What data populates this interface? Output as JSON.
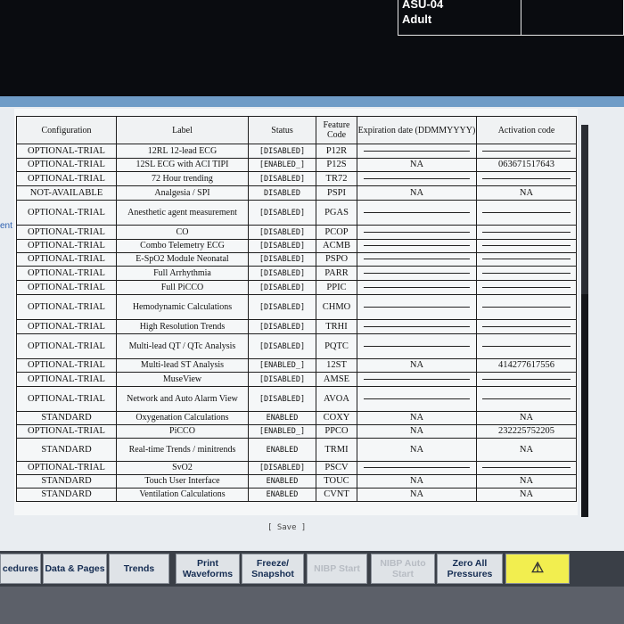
{
  "patient": {
    "line1": "ASU-04",
    "line2": "Adult"
  },
  "side_label": "ent",
  "table": {
    "headers": {
      "config": "Configuration",
      "label": "Label",
      "status": "Status",
      "feature": "Feature Code",
      "expiration": "Expiration date (DDMMYYYY)",
      "activation": "Activation code"
    },
    "rows": [
      {
        "config": "OPTIONAL-TRIAL",
        "label": "12RL 12-lead ECG",
        "status": "[DISABLED]",
        "feature": "P12R",
        "exp": "",
        "act": ""
      },
      {
        "config": "OPTIONAL-TRIAL",
        "label": "12SL ECG with ACI TIPI",
        "status": "[ENABLED_]",
        "feature": "P12S",
        "exp": "NA",
        "act": "063671517643"
      },
      {
        "config": "OPTIONAL-TRIAL",
        "label": "72 Hour trending",
        "status": "[DISABLED]",
        "feature": "TR72",
        "exp": "",
        "act": ""
      },
      {
        "config": "NOT-AVAILABLE",
        "label": "Analgesia / SPI",
        "status": "DISABLED",
        "feature": "PSPI",
        "exp": "NA",
        "act": "NA"
      },
      {
        "config": "OPTIONAL-TRIAL",
        "label": "Anesthetic agent measurement",
        "status": "[DISABLED]",
        "feature": "PGAS",
        "exp": "",
        "act": ""
      },
      {
        "config": "OPTIONAL-TRIAL",
        "label": "CO",
        "status": "[DISABLED]",
        "feature": "PCOP",
        "exp": "",
        "act": ""
      },
      {
        "config": "OPTIONAL-TRIAL",
        "label": "Combo Telemetry ECG",
        "status": "[DISABLED]",
        "feature": "ACMB",
        "exp": "",
        "act": ""
      },
      {
        "config": "OPTIONAL-TRIAL",
        "label": "E-SpO2 Module Neonatal",
        "status": "[DISABLED]",
        "feature": "PSPO",
        "exp": "",
        "act": ""
      },
      {
        "config": "OPTIONAL-TRIAL",
        "label": "Full Arrhythmia",
        "status": "[DISABLED]",
        "feature": "PARR",
        "exp": "",
        "act": ""
      },
      {
        "config": "OPTIONAL-TRIAL",
        "label": "Full PiCCO",
        "status": "[DISABLED]",
        "feature": "PPIC",
        "exp": "",
        "act": ""
      },
      {
        "config": "OPTIONAL-TRIAL",
        "label": "Hemodynamic Calculations",
        "status": "[DISABLED]",
        "feature": "CHMO",
        "exp": "",
        "act": ""
      },
      {
        "config": "OPTIONAL-TRIAL",
        "label": "High Resolution Trends",
        "status": "[DISABLED]",
        "feature": "TRHI",
        "exp": "",
        "act": ""
      },
      {
        "config": "OPTIONAL-TRIAL",
        "label": "Multi-lead QT / QTc Analysis",
        "status": "[DISABLED]",
        "feature": "PQTC",
        "exp": "",
        "act": ""
      },
      {
        "config": "OPTIONAL-TRIAL",
        "label": "Multi-lead ST Analysis",
        "status": "[ENABLED_]",
        "feature": "12ST",
        "exp": "NA",
        "act": "414277617556"
      },
      {
        "config": "OPTIONAL-TRIAL",
        "label": "MuseView",
        "status": "[DISABLED]",
        "feature": "AMSE",
        "exp": "",
        "act": ""
      },
      {
        "config": "OPTIONAL-TRIAL",
        "label": "Network and Auto Alarm View",
        "status": "[DISABLED]",
        "feature": "AVOA",
        "exp": "",
        "act": ""
      },
      {
        "config": "STANDARD",
        "label": "Oxygenation Calculations",
        "status": "ENABLED",
        "feature": "COXY",
        "exp": "NA",
        "act": "NA"
      },
      {
        "config": "OPTIONAL-TRIAL",
        "label": "PiCCO",
        "status": "[ENABLED_]",
        "feature": "PPCO",
        "exp": "NA",
        "act": "232225752205"
      },
      {
        "config": "STANDARD",
        "label": "Real-time Trends / minitrends",
        "status": "ENABLED",
        "feature": "TRMI",
        "exp": "NA",
        "act": "NA"
      },
      {
        "config": "OPTIONAL-TRIAL",
        "label": "SvO2",
        "status": "[DISABLED]",
        "feature": "PSCV",
        "exp": "",
        "act": ""
      },
      {
        "config": "STANDARD",
        "label": "Touch User Interface",
        "status": "ENABLED",
        "feature": "TOUC",
        "exp": "NA",
        "act": "NA"
      },
      {
        "config": "STANDARD",
        "label": "Ventilation Calculations",
        "status": "ENABLED",
        "feature": "CVNT",
        "exp": "NA",
        "act": "NA"
      }
    ]
  },
  "save_label": "[ Save ]",
  "buttons": [
    {
      "label": "cedures",
      "disabled": false
    },
    {
      "label": "Data & Pages",
      "disabled": false
    },
    {
      "label": "Trends",
      "disabled": false
    },
    {
      "label": "Print Waveforms",
      "disabled": false
    },
    {
      "label": "Freeze/ Snapshot",
      "disabled": false
    },
    {
      "label": "NIBP Start",
      "disabled": true
    },
    {
      "label": "NIBP Auto Start",
      "disabled": true
    },
    {
      "label": "Zero All Pressures",
      "disabled": false
    }
  ],
  "alarm_icon": "alarm-bell-icon"
}
